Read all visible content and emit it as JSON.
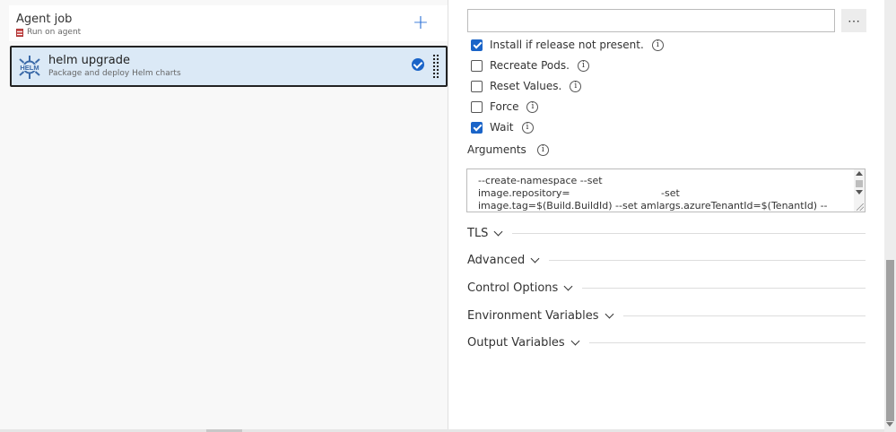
{
  "agent_job": {
    "title": "Agent job",
    "subtitle": "Run on agent",
    "add_icon": "plus-icon",
    "add_label": "+"
  },
  "task": {
    "title": "helm upgrade",
    "subtitle": "Package and deploy Helm charts",
    "logo_text": "HELM",
    "selected_icon": "check-circle-icon",
    "accent": "#1a64c8",
    "selected_bg": "#dbe9f6"
  },
  "form": {
    "top_input": {
      "value": "",
      "placeholder": ""
    },
    "more_label": "⋯",
    "options": [
      {
        "label": "Install if release not present.",
        "checked": true
      },
      {
        "label": "Recreate Pods.",
        "checked": false
      },
      {
        "label": "Reset Values.",
        "checked": false
      },
      {
        "label": "Force",
        "checked": false
      },
      {
        "label": "Wait",
        "checked": true
      }
    ],
    "info_glyph": "i",
    "arguments": {
      "label": "Arguments",
      "value": "--create-namespace --set\nimage.repository=                             -set\nimage.tag=$(Build.BuildId) --set amlargs.azureTenantId=$(TenantId) --set"
    },
    "sections": [
      {
        "title": "TLS"
      },
      {
        "title": "Advanced"
      },
      {
        "title": "Control Options"
      },
      {
        "title": "Environment Variables"
      },
      {
        "title": "Output Variables"
      }
    ]
  }
}
